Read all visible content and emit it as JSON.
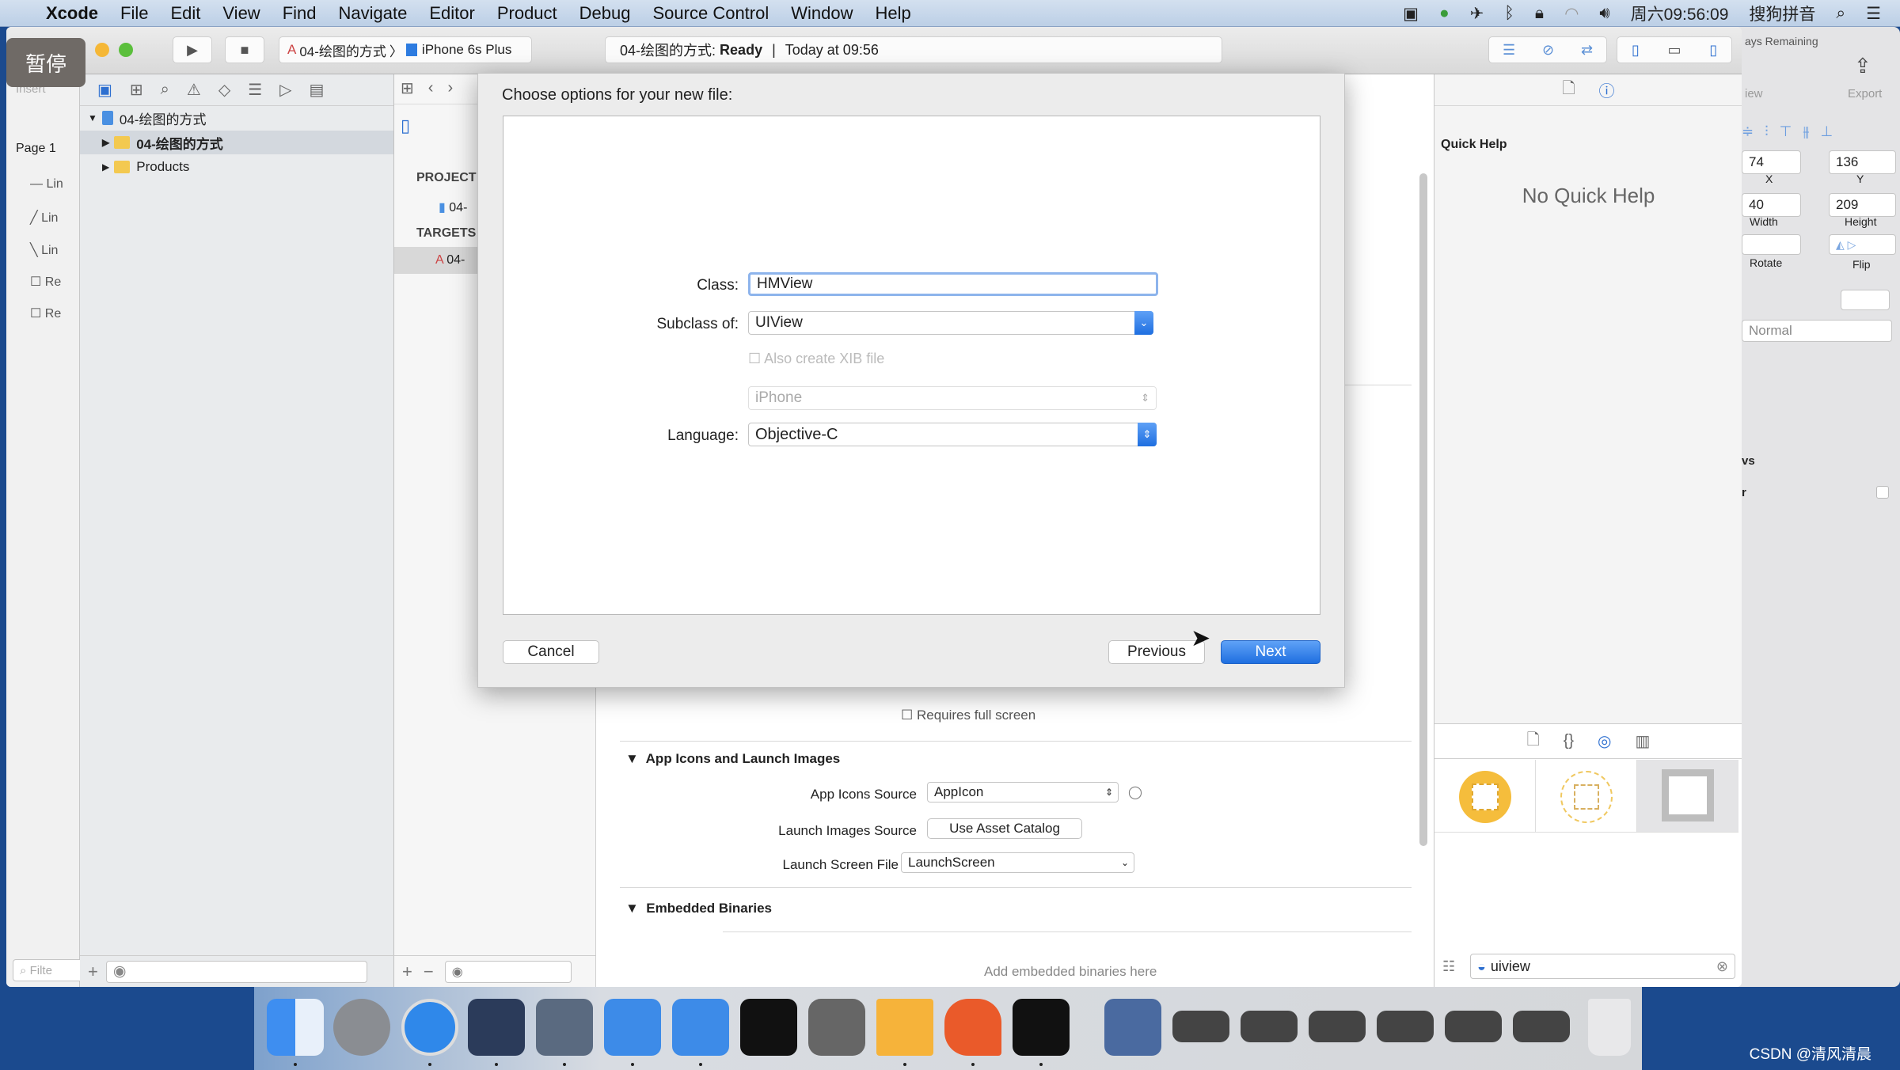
{
  "menubar": {
    "app": "Xcode",
    "items": [
      "File",
      "Edit",
      "View",
      "Find",
      "Navigate",
      "Editor",
      "Product",
      "Debug",
      "Source Control",
      "Window",
      "Help"
    ],
    "clock": "周六09:56:09",
    "ime": "搜狗拼音"
  },
  "overlay": {
    "pause": "暂停"
  },
  "toolbar": {
    "scheme": "04-绘图的方式",
    "device": "iPhone 6s Plus",
    "status_project": "04-绘图的方式:",
    "status_state": "Ready",
    "status_time": "Today at 09:56"
  },
  "library": {
    "insert": "Insert",
    "page": "Page 1",
    "items": [
      "Lin",
      "Lin",
      "Lin",
      "Re",
      "Re"
    ],
    "filter": "Filte"
  },
  "navigator": {
    "root": "04-绘图的方式",
    "children": [
      "04-绘图的方式",
      "Products"
    ]
  },
  "project_list": {
    "project_header": "PROJECT",
    "project_item": "04-",
    "targets_header": "TARGETS",
    "target_item": "04-"
  },
  "editor": {
    "requires_full_screen": "Requires full screen",
    "app_icons_section": "App Icons and Launch Images",
    "app_icons_source_label": "App Icons Source",
    "app_icons_source_value": "AppIcon",
    "launch_images_label": "Launch Images Source",
    "launch_images_button": "Use Asset Catalog",
    "launch_screen_label": "Launch Screen File",
    "launch_screen_value": "LaunchScreen",
    "embedded_section": "Embedded Binaries",
    "embedded_placeholder": "Add embedded binaries here"
  },
  "sheet": {
    "title": "Choose options for your new file:",
    "class_label": "Class:",
    "class_value": "HMView",
    "subclass_label": "Subclass of:",
    "subclass_value": "UIView",
    "xib_label": "Also create XIB file",
    "device_value": "iPhone",
    "language_label": "Language:",
    "language_value": "Objective-C",
    "cancel": "Cancel",
    "previous": "Previous",
    "next": "Next"
  },
  "inspector": {
    "quick_help_title": "Quick Help",
    "no_quick_help": "No Quick Help",
    "library_search": "uiview"
  },
  "backwin": {
    "days": "ays Remaining",
    "view": "iew",
    "export": "Export",
    "x_value": "74",
    "y_value": "136",
    "x_label": "X",
    "y_label": "Y",
    "width_value": "40",
    "height_value": "209",
    "width_label": "Width",
    "height_label": "Height",
    "rotate_label": "Rotate",
    "flip_label": "Flip",
    "blend": "Normal",
    "vs": "vs",
    "r": "r"
  },
  "watermark": "CSDN @清风清晨",
  "colors": {
    "accent": "#1f6fe0",
    "desktop": "#1b4a8e",
    "folder": "#f3c950"
  }
}
